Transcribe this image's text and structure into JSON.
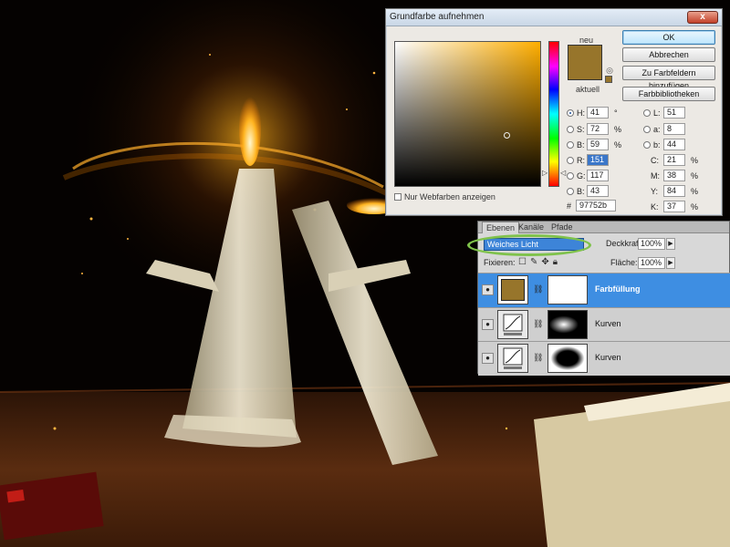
{
  "color_picker": {
    "title": "Grundfarbe aufnehmen",
    "close_label": "x",
    "new_label": "neu",
    "current_label": "aktuell",
    "new_color": "#97752b",
    "current_color": "#97752b",
    "buttons": {
      "ok": "OK",
      "cancel": "Abbrechen",
      "add_to_swatches": "Zu Farbfeldern hinzufügen",
      "color_libraries": "Farbbibliotheken"
    },
    "fields": {
      "h": {
        "label": "H:",
        "value": "41",
        "unit": "°"
      },
      "s": {
        "label": "S:",
        "value": "72",
        "unit": "%"
      },
      "b": {
        "label": "B:",
        "value": "59",
        "unit": "%"
      },
      "r": {
        "label": "R:",
        "value": "151"
      },
      "g": {
        "label": "G:",
        "value": "117"
      },
      "bb": {
        "label": "B:",
        "value": "43"
      },
      "l": {
        "label": "L:",
        "value": "51"
      },
      "a": {
        "label": "a:",
        "value": "8"
      },
      "lb": {
        "label": "b:",
        "value": "44"
      },
      "c": {
        "label": "C:",
        "value": "21",
        "unit": "%"
      },
      "m": {
        "label": "M:",
        "value": "38",
        "unit": "%"
      },
      "y": {
        "label": "Y:",
        "value": "84",
        "unit": "%"
      },
      "k": {
        "label": "K:",
        "value": "37",
        "unit": "%"
      }
    },
    "hex_label": "#",
    "hex_value": "97752b",
    "web_colors_label": "Nur Webfarben anzeigen"
  },
  "layers_panel": {
    "tabs": [
      "Ebenen",
      "Kanäle",
      "Pfade"
    ],
    "blend_mode": "Weiches Licht",
    "opacity_label": "Deckkraft:",
    "opacity_value": "100%",
    "lock_label": "Fixieren:",
    "fill_label": "Fläche:",
    "fill_value": "100%",
    "layers": [
      {
        "name": "Farbfüllung",
        "selected": true,
        "color": "#97752b"
      },
      {
        "name": "Kurven",
        "selected": false
      },
      {
        "name": "Kurven",
        "selected": false
      }
    ]
  },
  "colors": {
    "accent_selection": "#3e8ee2",
    "highlight_ring": "#7fc24b"
  }
}
